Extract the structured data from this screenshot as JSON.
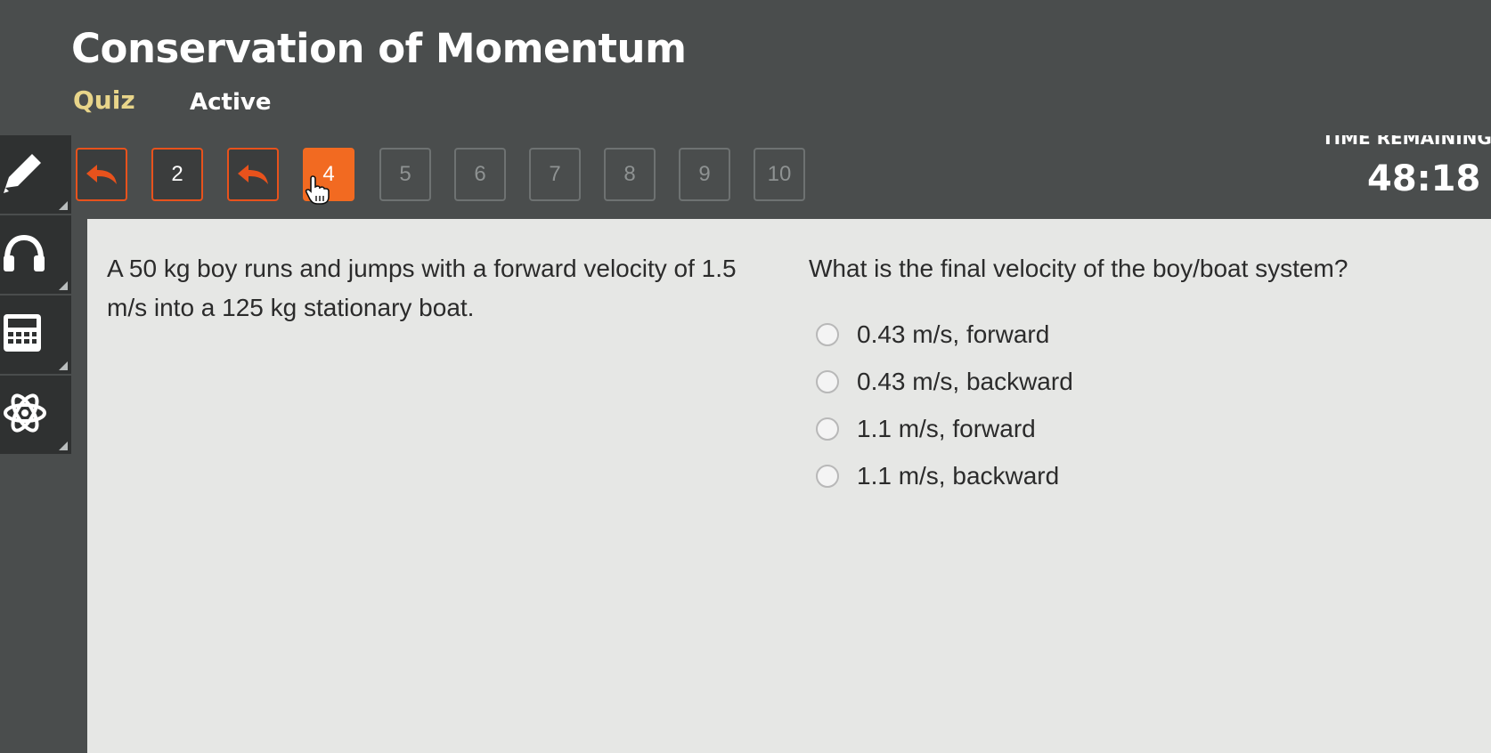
{
  "header": {
    "title": "Conservation of Momentum",
    "type": "Quiz",
    "status": "Active"
  },
  "timer": {
    "label": "TIME REMAINING",
    "value": "48:18"
  },
  "nav": {
    "items": [
      {
        "label": "",
        "state": "flag",
        "icon": "back-arrow-icon"
      },
      {
        "label": "2",
        "state": "answered"
      },
      {
        "label": "",
        "state": "flag",
        "icon": "back-arrow-icon"
      },
      {
        "label": "4",
        "state": "current"
      },
      {
        "label": "5",
        "state": "future"
      },
      {
        "label": "6",
        "state": "future"
      },
      {
        "label": "7",
        "state": "future"
      },
      {
        "label": "8",
        "state": "future"
      },
      {
        "label": "9",
        "state": "future"
      },
      {
        "label": "10",
        "state": "future"
      }
    ]
  },
  "toolbar": {
    "tools": [
      "pencil-icon",
      "headphones-icon",
      "calculator-icon",
      "atom-icon"
    ]
  },
  "question": {
    "stem": "A 50 kg boy runs and jumps with a forward velocity of 1.5 m/s into a 125 kg stationary boat.",
    "prompt": "What is the final velocity of the boy/boat system?",
    "choices": [
      "0.43 m/s, forward",
      "0.43 m/s, backward",
      "1.1 m/s, forward",
      "1.1 m/s, backward"
    ]
  },
  "colors": {
    "background": "#4a4d4d",
    "accent": "#f26a21",
    "panel": "#e6e7e5",
    "quiz_label": "#e8d58a"
  }
}
